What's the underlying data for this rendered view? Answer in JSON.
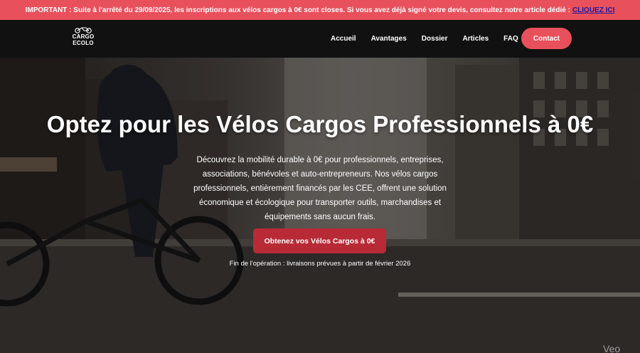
{
  "banner": {
    "text": "IMPORTANT : Suite à l'arrêté du 29/09/2025, les inscriptions aux vélos cargos à 0€ sont closes. Si vous avez déjà signé votre devis, consultez notre article dédié :",
    "link": "CLIQUEZ ICI"
  },
  "nav": {
    "logo_line1": "CARGO",
    "logo_line2": "ECOLO",
    "links": [
      "Accueil",
      "Avantages",
      "Dossier",
      "Articles",
      "FAQ"
    ],
    "contact": "Contact"
  },
  "hero": {
    "title": "Optez pour les Vélos Cargos Professionnels à 0€",
    "description": "Découvrez la mobilité durable à 0€ pour professionnels, entreprises, associations, bénévoles et auto-entrepreneurs. Nos vélos cargos professionnels, entièrement financés par les CEE, offrent une solution économique et écologique pour transporter outils, marchandises et équipements sans aucun frais.",
    "cta": "Obtenez vos Vélos Cargos à 0€",
    "note": "Fin de l'opération : livraisons prévues à partir de février 2026",
    "watermark": "Veo"
  },
  "colors": {
    "accent": "#e8505b",
    "cta": "#b82a35",
    "banner_link": "#1a1aa6",
    "nav_bg": "#111111"
  }
}
